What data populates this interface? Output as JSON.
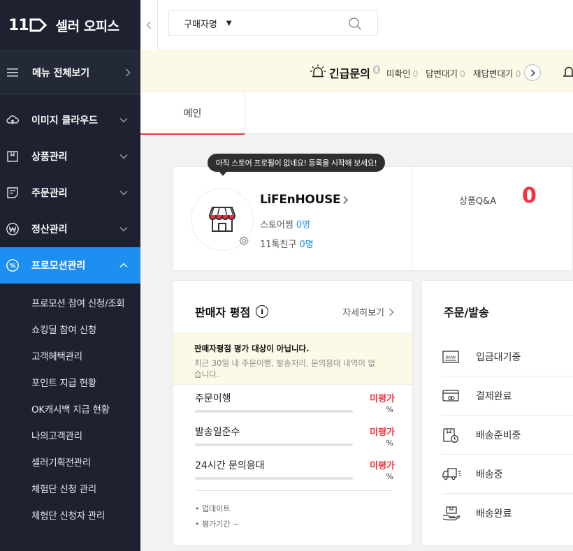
{
  "brand": {
    "logo": "11",
    "name": "셀러 오피스"
  },
  "sidebar": {
    "menu_all": "메뉴 전체보기",
    "items": [
      {
        "label": "이미지 클라우드",
        "icon": "cloud-icon"
      },
      {
        "label": "상품관리",
        "icon": "box-icon"
      },
      {
        "label": "주문관리",
        "icon": "order-list-icon"
      },
      {
        "label": "정산관리",
        "icon": "won-icon"
      },
      {
        "label": "프로모션관리",
        "icon": "percent-icon",
        "active": true
      }
    ],
    "submenu": [
      "프로모션 참여 신청/조회",
      "쇼킹딜 참여 신청",
      "고객혜택관리",
      "포인트 지급 현황",
      "OK캐시백 지급 현황",
      "나의고객관리",
      "셀러기획전관리",
      "체험단 신청 관리",
      "체험단 신청자 관리"
    ]
  },
  "search": {
    "select_value": "구매자명"
  },
  "alert": {
    "title": "긴급문의",
    "count": "0",
    "unread_label": "미확인",
    "unread_count": "0",
    "waiting_label": "답변대기",
    "waiting_count": "0",
    "rewaiting_label": "재답변대기",
    "rewaiting_count": "0"
  },
  "tabs": [
    {
      "label": "메인",
      "active": true
    }
  ],
  "profile": {
    "tooltip": "아직 스토어 프로필이 없네요! 등록을 시작해 보세요!",
    "store_name": "LiFEnHOUSE",
    "zzim_label": "스토어찜",
    "zzim_count": "0명",
    "friends_label": "11톡친구",
    "friends_count": "0명",
    "qa_label": "상품Q&A",
    "qa_count": "0"
  },
  "rating": {
    "title": "판매자 평점",
    "detail_link": "자세히보기",
    "notice_title": "판매자평점 평가 대상이 아닙니다.",
    "notice_body_line1": "최근 30일 내 주문이행, 발송처리, 문의응대 내역이 없",
    "notice_body_line2": "습니다.",
    "metrics": [
      {
        "name": "주문이행",
        "eval": "미평가",
        "pct": "%"
      },
      {
        "name": "발송일준수",
        "eval": "미평가",
        "pct": "%"
      },
      {
        "name": "24시간 문의응대",
        "eval": "미평가",
        "pct": "%"
      }
    ],
    "footer": [
      "• 업데이트",
      "• 평가기간  ~"
    ]
  },
  "order": {
    "title": "주문/발송",
    "rows": [
      {
        "label": "입금대기중",
        "icon": "bank-icon"
      },
      {
        "label": "결제완료",
        "icon": "card-icon"
      },
      {
        "label": "배송준비중",
        "icon": "package-clock-icon"
      },
      {
        "label": "배송중",
        "icon": "truck-icon"
      },
      {
        "label": "배송완료",
        "icon": "box-hand-icon"
      }
    ]
  },
  "colors": {
    "sidebar_bg": "#1d2130",
    "active_blue": "#1c8ff0",
    "accent_red": "#f43142",
    "notice_bg": "#fdf9e7"
  }
}
